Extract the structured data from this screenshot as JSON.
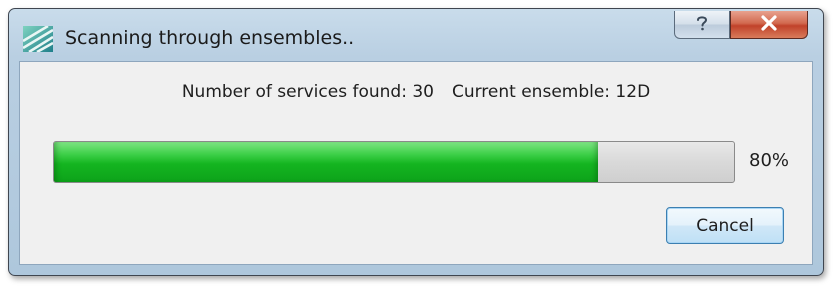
{
  "window": {
    "title": "Scanning through ensembles..",
    "app_icon": "striped-app-icon",
    "help_icon": "question-mark-icon",
    "close_icon": "close-x-icon"
  },
  "status": {
    "services_found_text": "Number of services found: 30",
    "current_ensemble_text": "Current ensemble: 12D"
  },
  "progress": {
    "value_percent": 80,
    "label": "80%",
    "fill_color": "#14b520"
  },
  "buttons": {
    "cancel_label": "Cancel"
  }
}
